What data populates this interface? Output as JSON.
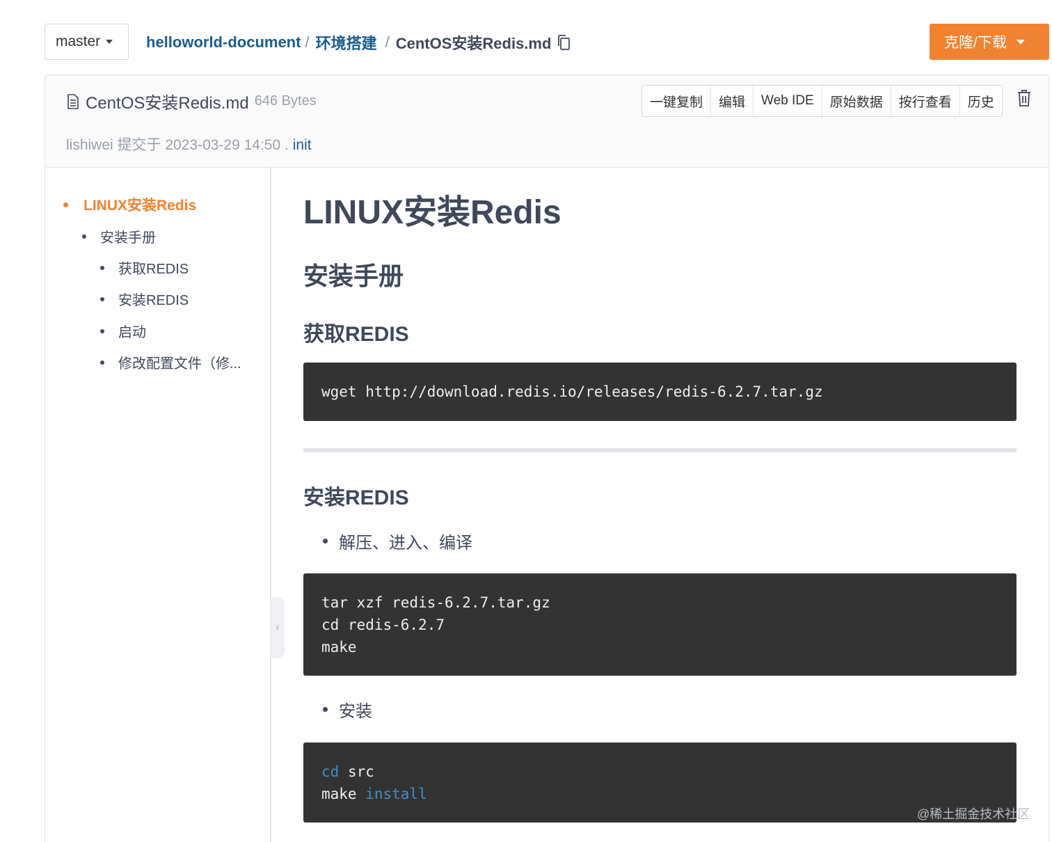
{
  "branch": {
    "label": "master"
  },
  "breadcrumb": {
    "repo": "helloworld-document",
    "folder": "环境搭建",
    "file": "CentOS安装Redis.md",
    "separator": "/"
  },
  "clone_button": {
    "label": "克隆/下载"
  },
  "file_header": {
    "name": "CentOS安装Redis.md",
    "size": "646 Bytes",
    "commit_info": "lishiwei 提交于 2023-03-29 14:50 .",
    "commit_message": "init"
  },
  "actions": {
    "copy": "一键复制",
    "edit": "编辑",
    "web_ide": "Web IDE",
    "raw": "原始数据",
    "blame": "按行查看",
    "history": "历史"
  },
  "toc": {
    "items": [
      {
        "label": "LINUX安装Redis"
      },
      {
        "label": "安装手册"
      },
      {
        "label": "获取REDIS"
      },
      {
        "label": "安装REDIS"
      },
      {
        "label": "启动"
      },
      {
        "label": "修改配置文件（修..."
      }
    ]
  },
  "content": {
    "h1": "LINUX安装Redis",
    "h2": "安装手册",
    "h3_get": "获取REDIS",
    "code_get": "wget http://download.redis.io/releases/redis-6.2.7.tar.gz",
    "h3_install": "安装REDIS",
    "bullet_extract": "解压、进入、编译",
    "code_extract": [
      "tar xzf redis-6.2.7.tar.gz",
      "cd redis-6.2.7",
      "make"
    ],
    "bullet_install": "安装",
    "code_install": {
      "line1_kw": "cd",
      "line1_rest": " src",
      "line2_plain": "make ",
      "line2_kw": "install"
    }
  },
  "watermark": "@稀土掘金技术社区",
  "colors": {
    "accent": "#ef8332",
    "link": "#1a5d8f",
    "code_bg": "#333333",
    "code_keyword": "#3d8fc8"
  }
}
